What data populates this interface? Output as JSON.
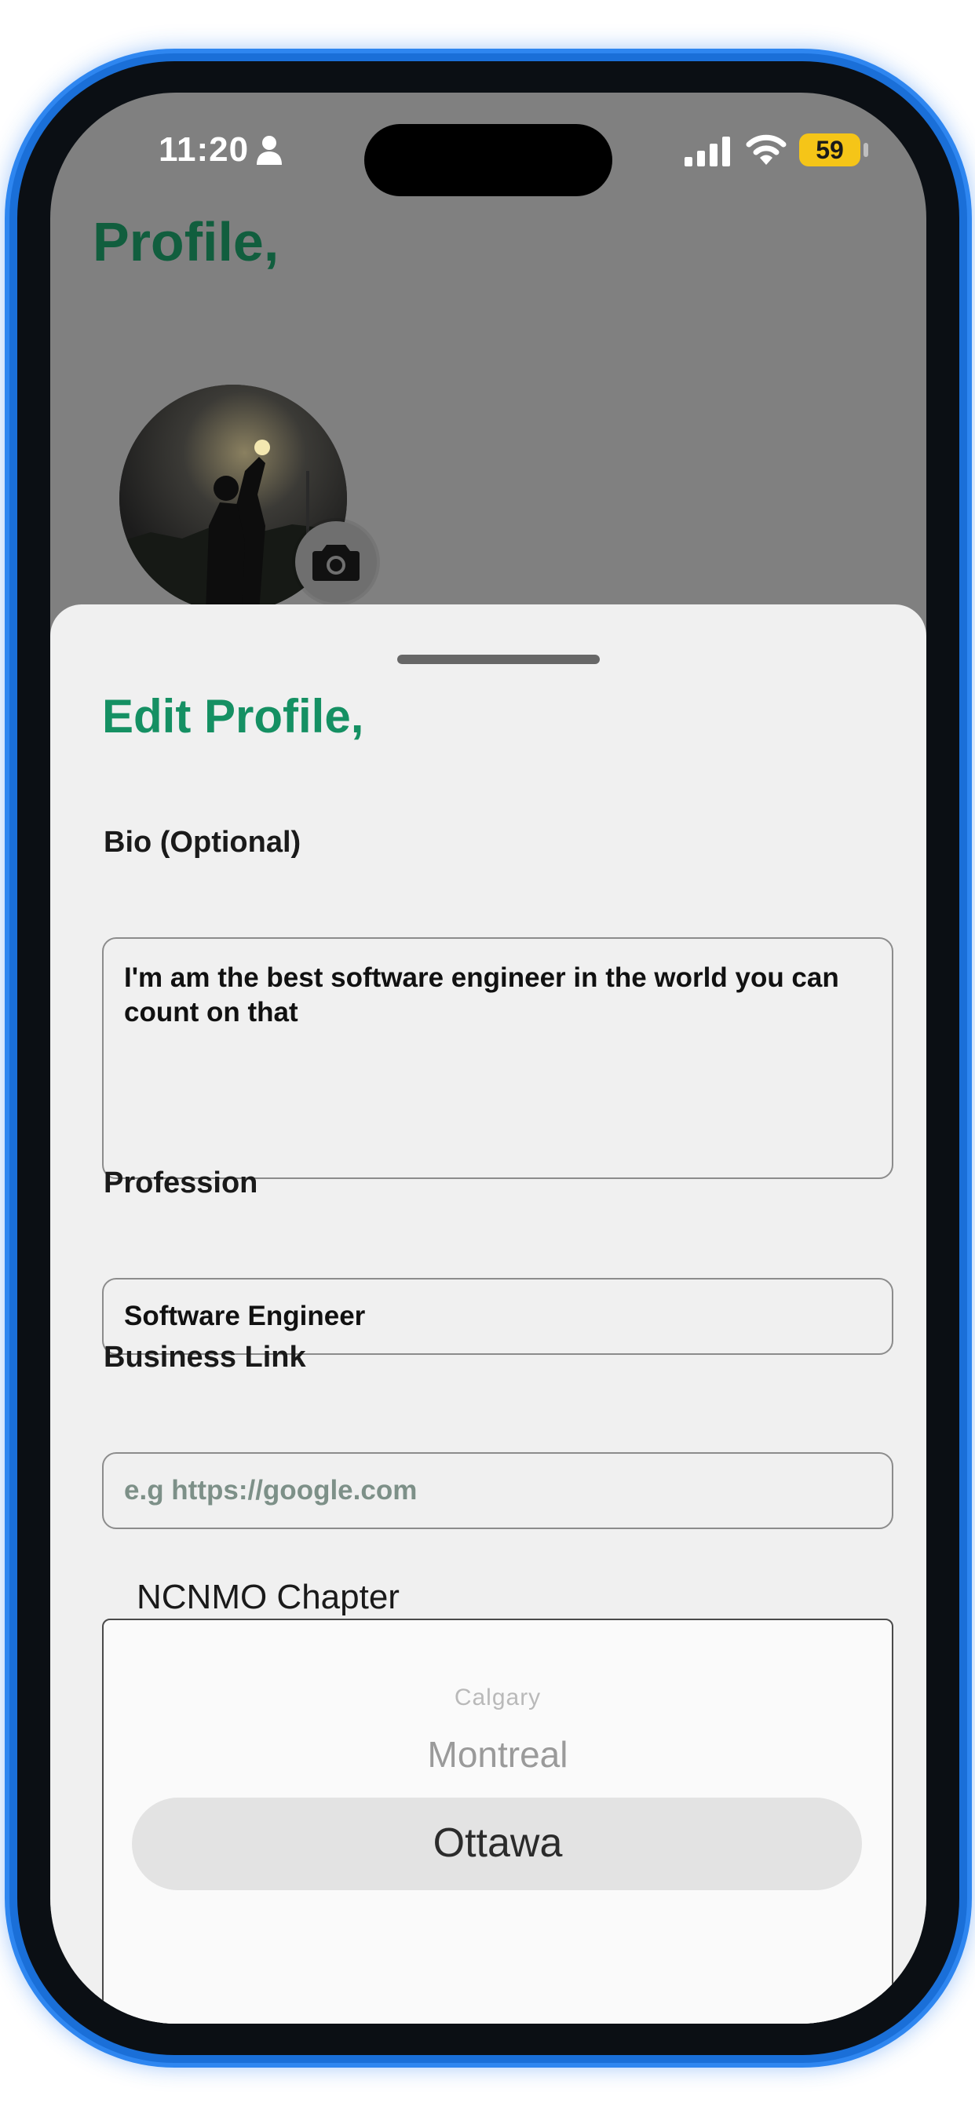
{
  "status_bar": {
    "time": "11:20",
    "battery": "59"
  },
  "header": {
    "title": "Profile,"
  },
  "icons": {
    "person": "person-icon",
    "signal": "signal-icon",
    "wifi": "wifi-icon",
    "camera": "camera-icon"
  },
  "sheet": {
    "title": "Edit Profile,",
    "bio": {
      "label": "Bio (Optional)",
      "value": "I'm am the best software engineer in the world you can count on that"
    },
    "profession": {
      "label": "Profession",
      "value": "Software Engineer"
    },
    "business_link": {
      "label": "Business Link",
      "placeholder": "e.g https://google.com"
    },
    "chapter": {
      "label": "NCNMO Chapter",
      "options": [
        "Calgary",
        "Montreal",
        "Ottawa"
      ],
      "selected": "Ottawa"
    }
  },
  "colors": {
    "profile_title": "#115e3e",
    "sheet_title": "#159063",
    "battery": "#f5c518",
    "phone_glow": "#1a6fd8"
  }
}
